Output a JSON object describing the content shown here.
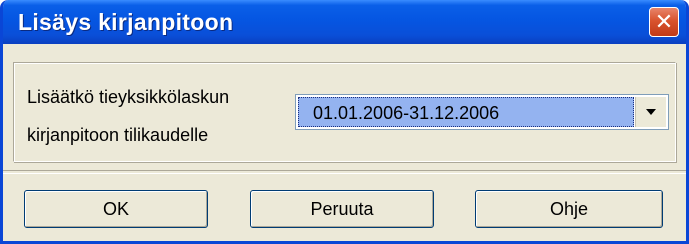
{
  "dialog": {
    "title": "Lisäys kirjanpitoon",
    "close_icon": "close-icon",
    "prompt": "Lisäätkö tieyksikkölaskun\nkirjanpitoon tilikaudelle",
    "period_select": {
      "value": "01.01.2006-31.12.2006"
    },
    "buttons": {
      "ok": "OK",
      "cancel": "Peruuta",
      "help": "Ohje"
    },
    "colors": {
      "titlebar": "#0556e2",
      "close": "#d9532e",
      "face": "#ece9d8",
      "selection": "#94b3f0"
    }
  }
}
